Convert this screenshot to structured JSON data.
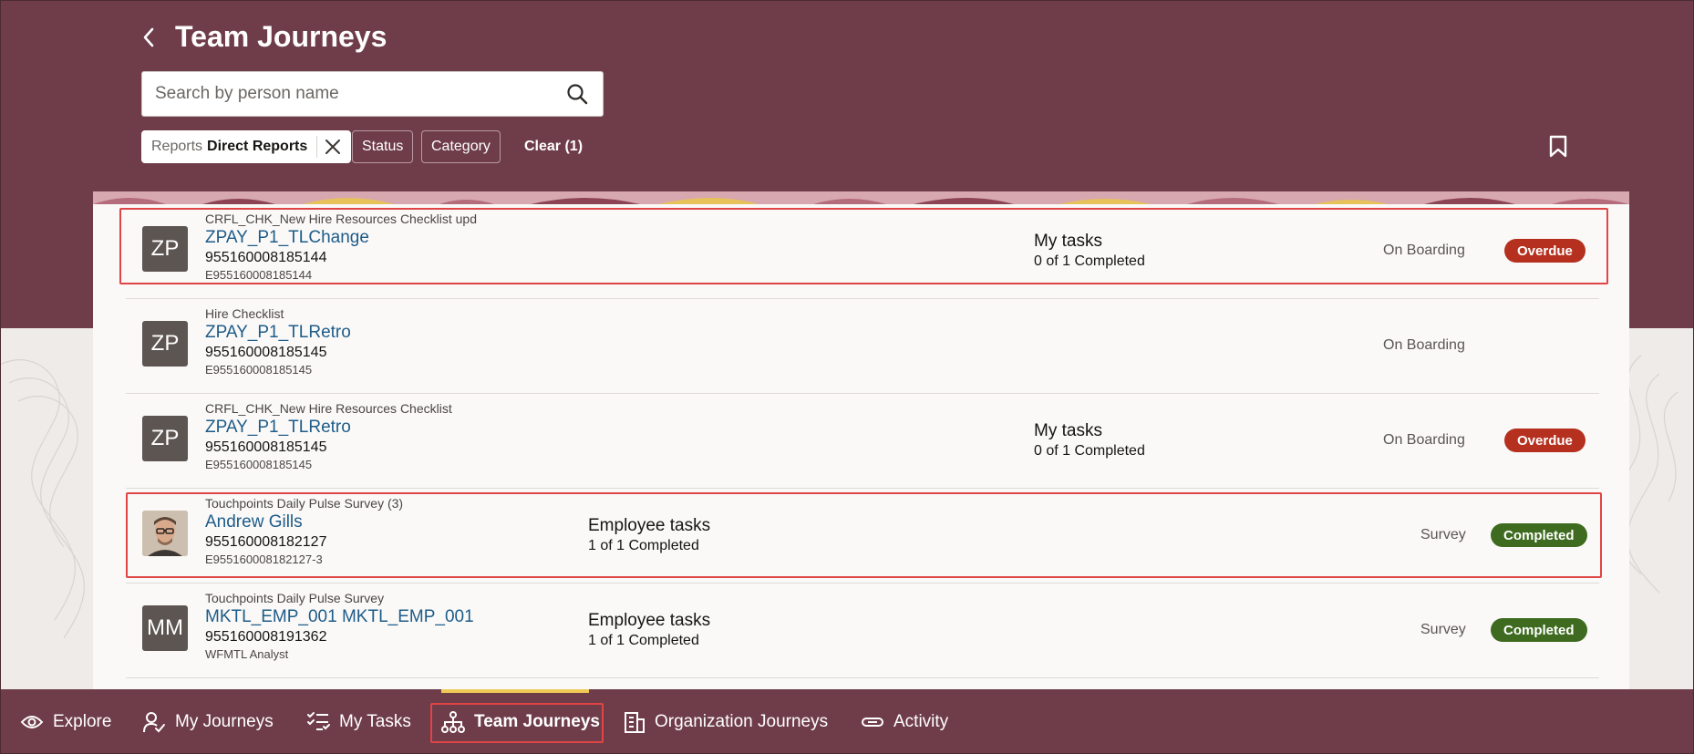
{
  "header": {
    "title": "Team Journeys",
    "search_placeholder": "Search by person name"
  },
  "filters": {
    "reports_chip": {
      "key": "Reports",
      "value": "Direct Reports"
    },
    "status_label": "Status",
    "category_label": "Category",
    "clear_label": "Clear (1)"
  },
  "rows": [
    {
      "category": "CRFL_CHK_New Hire Resources Checklist upd",
      "name": "ZPAY_P1_TLChange",
      "number": "955160008185144",
      "sub": "E955160008185144",
      "avatar": "ZP",
      "task_title": "My tasks",
      "task_status": "0 of 1 Completed",
      "type": "On Boarding",
      "badge": "Overdue"
    },
    {
      "category": "Hire Checklist",
      "name": "ZPAY_P1_TLRetro",
      "number": "955160008185145",
      "sub": "E955160008185145",
      "avatar": "ZP",
      "task_title": "",
      "task_status": "",
      "type": "On Boarding",
      "badge": ""
    },
    {
      "category": "CRFL_CHK_New Hire Resources Checklist",
      "name": "ZPAY_P1_TLRetro",
      "number": "955160008185145",
      "sub": "E955160008185145",
      "avatar": "ZP",
      "task_title": "My tasks",
      "task_status": "0 of 1 Completed",
      "type": "On Boarding",
      "badge": "Overdue"
    },
    {
      "category": "Touchpoints Daily Pulse Survey (3)",
      "name": "Andrew Gills",
      "number": "955160008182127",
      "sub": "E955160008182127-3",
      "avatar": "photo",
      "task_title": "Employee tasks",
      "task_status": "1 of 1 Completed",
      "type": "Survey",
      "badge": "Completed"
    },
    {
      "category": "Touchpoints Daily Pulse Survey",
      "name": "MKTL_EMP_001 MKTL_EMP_001",
      "number": "955160008191362",
      "sub": "WFMTL Analyst",
      "avatar": "MM",
      "task_title": "Employee tasks",
      "task_status": "1 of 1 Completed",
      "type": "Survey",
      "badge": "Completed"
    }
  ],
  "bottom_nav": {
    "items": [
      {
        "label": "Explore",
        "icon": "eye-icon"
      },
      {
        "label": "My Journeys",
        "icon": "person-check-icon"
      },
      {
        "label": "My Tasks",
        "icon": "checklist-icon"
      },
      {
        "label": "Team Journeys",
        "icon": "org-chart-icon"
      },
      {
        "label": "Organization Journeys",
        "icon": "building-icon"
      },
      {
        "label": "Activity",
        "icon": "link-icon"
      }
    ],
    "active": "Team Journeys"
  },
  "colors": {
    "header_bg": "#6f3d4a",
    "link": "#1e5c88",
    "overdue": "#b5301f",
    "completed": "#3e6b1f",
    "highlight": "#e04545",
    "active_tab": "#f0c955"
  }
}
